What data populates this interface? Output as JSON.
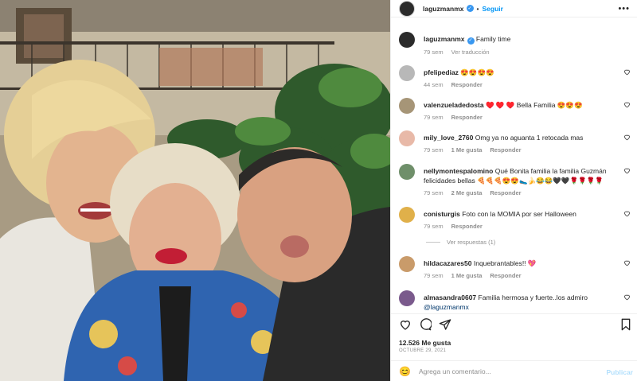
{
  "post": {
    "author": "laguzmanmx",
    "follow_label": "Seguir",
    "more_label": "•••",
    "caption_text": "Family time",
    "caption_time": "79 sem",
    "translate_label": "Ver traducción"
  },
  "comments": [
    {
      "user": "pfelipediaz",
      "text": "😍😍😍😍",
      "time": "44 sem",
      "likes": "",
      "reply": "Responder"
    },
    {
      "user": "valenzueladedosta",
      "text": "♥️ ♥️ ♥️ Bella Familia 😍😍😍",
      "time": "79 sem",
      "likes": "",
      "reply": "Responder"
    },
    {
      "user": "mily_love_2760",
      "text": "Omg ya no aguanta 1 retocada mas",
      "time": "79 sem",
      "likes": "1 Me gusta",
      "reply": "Responder"
    },
    {
      "user": "nellymontespalomino",
      "text": "Qué Bonita familia la familia Guzmán felicidades bellas 🍕🍕🍕😍😍🥿🍌😂😂🖤🖤🌹🌹🌹🌹",
      "time": "79 sem",
      "likes": "2 Me gusta",
      "reply": "Responder"
    },
    {
      "user": "conisturgis",
      "text": "Foto con la MOMIA por ser Halloween",
      "time": "79 sem",
      "likes": "",
      "reply": "Responder"
    },
    {
      "user": "hildacazares50",
      "text": "Inquebrantables!! 💖",
      "time": "79 sem",
      "likes": "1 Me gusta",
      "reply": "Responder"
    },
    {
      "user": "almasandra0607",
      "text": "Familia hermosa y fuerte..los admiro",
      "mention": "@laguzmanmx",
      "time": "",
      "likes": "",
      "reply": ""
    }
  ],
  "view_replies_label": "Ver respuestas (1)",
  "likes_count": "12.526 Me gusta",
  "post_date": "OCTUBRE 29, 2021",
  "comment_box": {
    "emoji_icon": "😊",
    "placeholder": "Agrega un comentario...",
    "publish_label": "Publicar"
  },
  "colors": {
    "accent": "#0095f6",
    "verified": "#3897f0",
    "meta_gray": "#8e8e8e",
    "publish_disabled": "#b2dffc"
  },
  "icons": {
    "verified": "verified-badge-icon",
    "like": "heart-icon",
    "comment": "comment-bubble-icon",
    "share": "paper-plane-icon",
    "save": "bookmark-icon"
  }
}
